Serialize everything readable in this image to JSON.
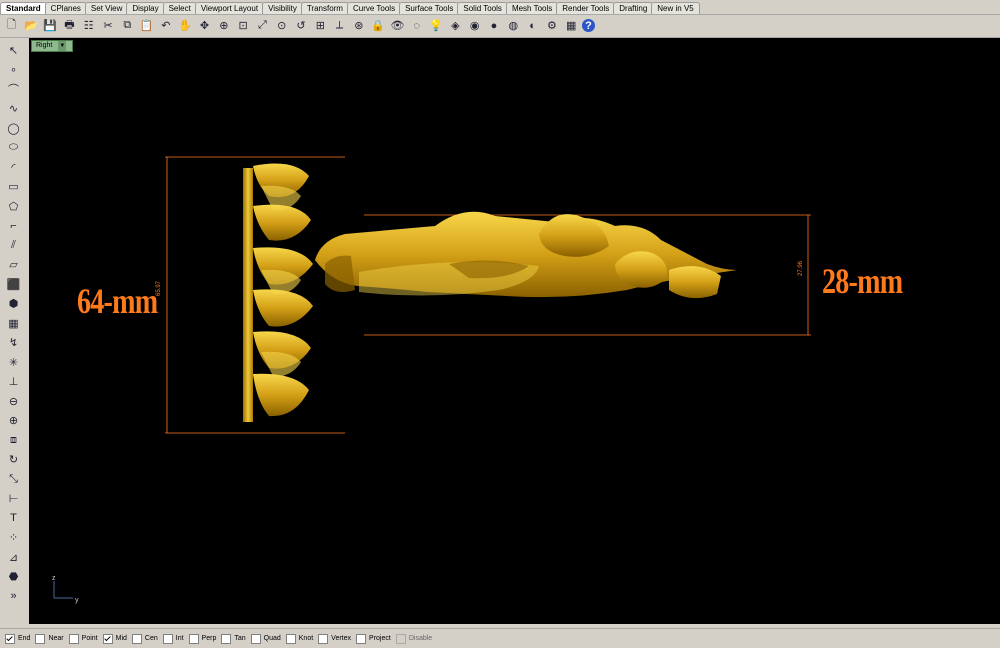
{
  "tabs": [
    "Standard",
    "CPlanes",
    "Set View",
    "Display",
    "Select",
    "Viewport Layout",
    "Visibility",
    "Transform",
    "Curve Tools",
    "Surface Tools",
    "Solid Tools",
    "Mesh Tools",
    "Render Tools",
    "Drafting",
    "New in V5"
  ],
  "active_tab": "Standard",
  "toolbar_icons": [
    "new-icon",
    "open-icon",
    "save-icon",
    "print-icon",
    "properties-icon",
    "cut-icon",
    "copy-icon",
    "paste-icon",
    "undo-icon",
    "pan-icon",
    "rotate-view-icon",
    "zoom-dynamic-icon",
    "zoom-window-icon",
    "zoom-extents-icon",
    "zoom-selected-icon",
    "undo-view-icon",
    "four-viewports-icon",
    "cplane-icon",
    "grid-snap-icon",
    "lock-icon",
    "show-objects-icon",
    "hide-objects-icon",
    "lightbulb-icon",
    "layer-icon",
    "color-wheel-icon",
    "shaded-sphere-icon",
    "rendered-sphere-icon",
    "material-sphere-icon",
    "options-icon",
    "grid-options-icon",
    "help-icon"
  ],
  "left_tool_icons": [
    "select-arrow-icon",
    "point-icon",
    "polyline-icon",
    "curve-icon",
    "circle-icon",
    "ellipse-icon",
    "arc-icon",
    "rectangle-icon",
    "polygon-icon",
    "fillet-icon",
    "offset-icon",
    "surface-icon",
    "solid-box-icon",
    "solid-union-icon",
    "mesh-icon",
    "curve-from-object-icon",
    "explode-icon",
    "split-icon",
    "boolean-icon",
    "join-icon",
    "group-icon",
    "rotate-icon",
    "scale-icon",
    "dimension-icon",
    "text-icon",
    "array-icon",
    "analyze-icon",
    "render-icon",
    "more-icon"
  ],
  "viewport": {
    "name": "Right",
    "dim_left": "64-mm",
    "dim_right": "28-mm",
    "dim_left_small": "65.97",
    "dim_right_small": "27.96",
    "axis_z": "z",
    "axis_y": "y"
  },
  "osnap": [
    {
      "label": "End",
      "checked": true
    },
    {
      "label": "Near",
      "checked": false
    },
    {
      "label": "Point",
      "checked": false
    },
    {
      "label": "Mid",
      "checked": true
    },
    {
      "label": "Cen",
      "checked": false
    },
    {
      "label": "Int",
      "checked": false
    },
    {
      "label": "Perp",
      "checked": false
    },
    {
      "label": "Tan",
      "checked": false
    },
    {
      "label": "Quad",
      "checked": false
    },
    {
      "label": "Knot",
      "checked": false
    },
    {
      "label": "Vertex",
      "checked": false
    },
    {
      "label": "Project",
      "checked": false
    },
    {
      "label": "Disable",
      "checked": false,
      "disabled": true
    }
  ],
  "colors": {
    "gold": "#d4a017",
    "dimension": "#ff7a1a",
    "viewport_bg": "#000000",
    "viewport_label": "#8fb98f"
  }
}
